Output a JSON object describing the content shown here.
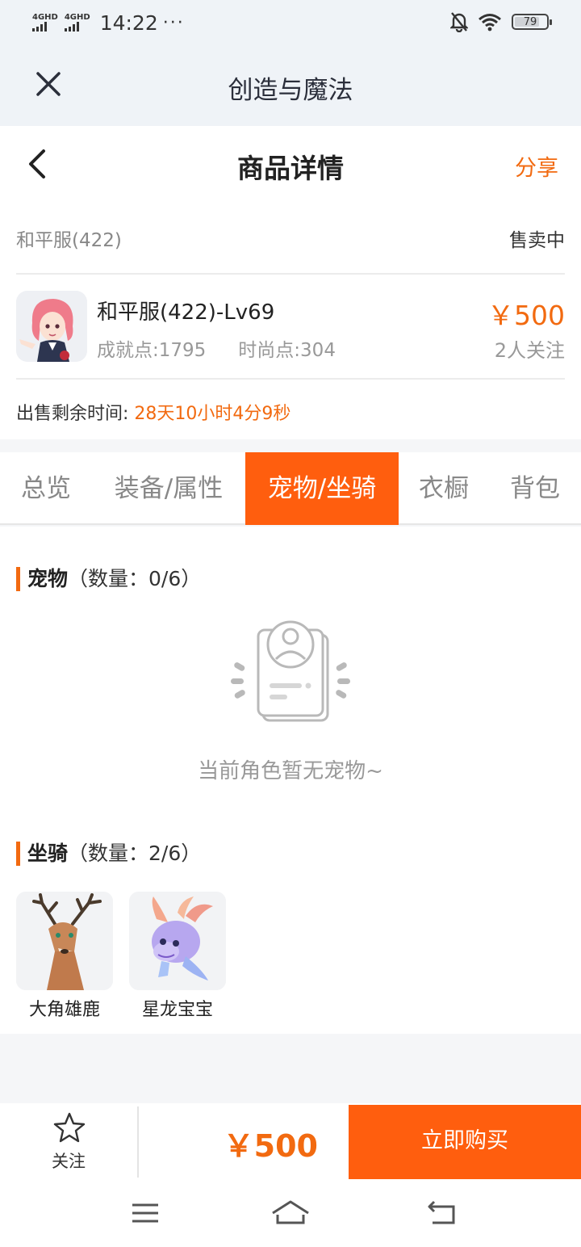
{
  "status_bar": {
    "network_1": "4GHD",
    "network_2": "4GHD",
    "time": "14:22",
    "more": "···",
    "battery": "79",
    "battery_level": 0.79
  },
  "app_header": {
    "title": "创造与魔法",
    "close_icon": "close-icon"
  },
  "detail_header": {
    "title": "商品详情",
    "share_label": "分享",
    "back_icon": "chevron-left-icon"
  },
  "product": {
    "server": "和平服(422)",
    "status": "售卖中",
    "name": "和平服(422)-Lv69",
    "achievement": "成就点:1795",
    "fashion": "时尚点:304",
    "price": "￥500",
    "followers": "2人关注",
    "time_left_label": "出售剩余时间:",
    "time_left_value": "28天10小时4分9秒"
  },
  "tabs": [
    {
      "label": "总览"
    },
    {
      "label": "装备/属性"
    },
    {
      "label": "宠物/坐骑"
    },
    {
      "label": "衣橱"
    },
    {
      "label": "背包"
    }
  ],
  "active_tab": 2,
  "pets": {
    "title": "宠物",
    "count": "（数量：0/6）",
    "empty_text": "当前角色暂无宠物~"
  },
  "mounts": {
    "title": "坐骑",
    "count": "（数量：2/6）",
    "items": [
      {
        "name": "大角雄鹿"
      },
      {
        "name": "星龙宝宝"
      }
    ]
  },
  "bottom_bar": {
    "follow_label": "关注",
    "price": "￥500",
    "buy_label": "立即购买"
  },
  "colors": {
    "accent": "#ff5e0e",
    "price": "#f26a10"
  }
}
